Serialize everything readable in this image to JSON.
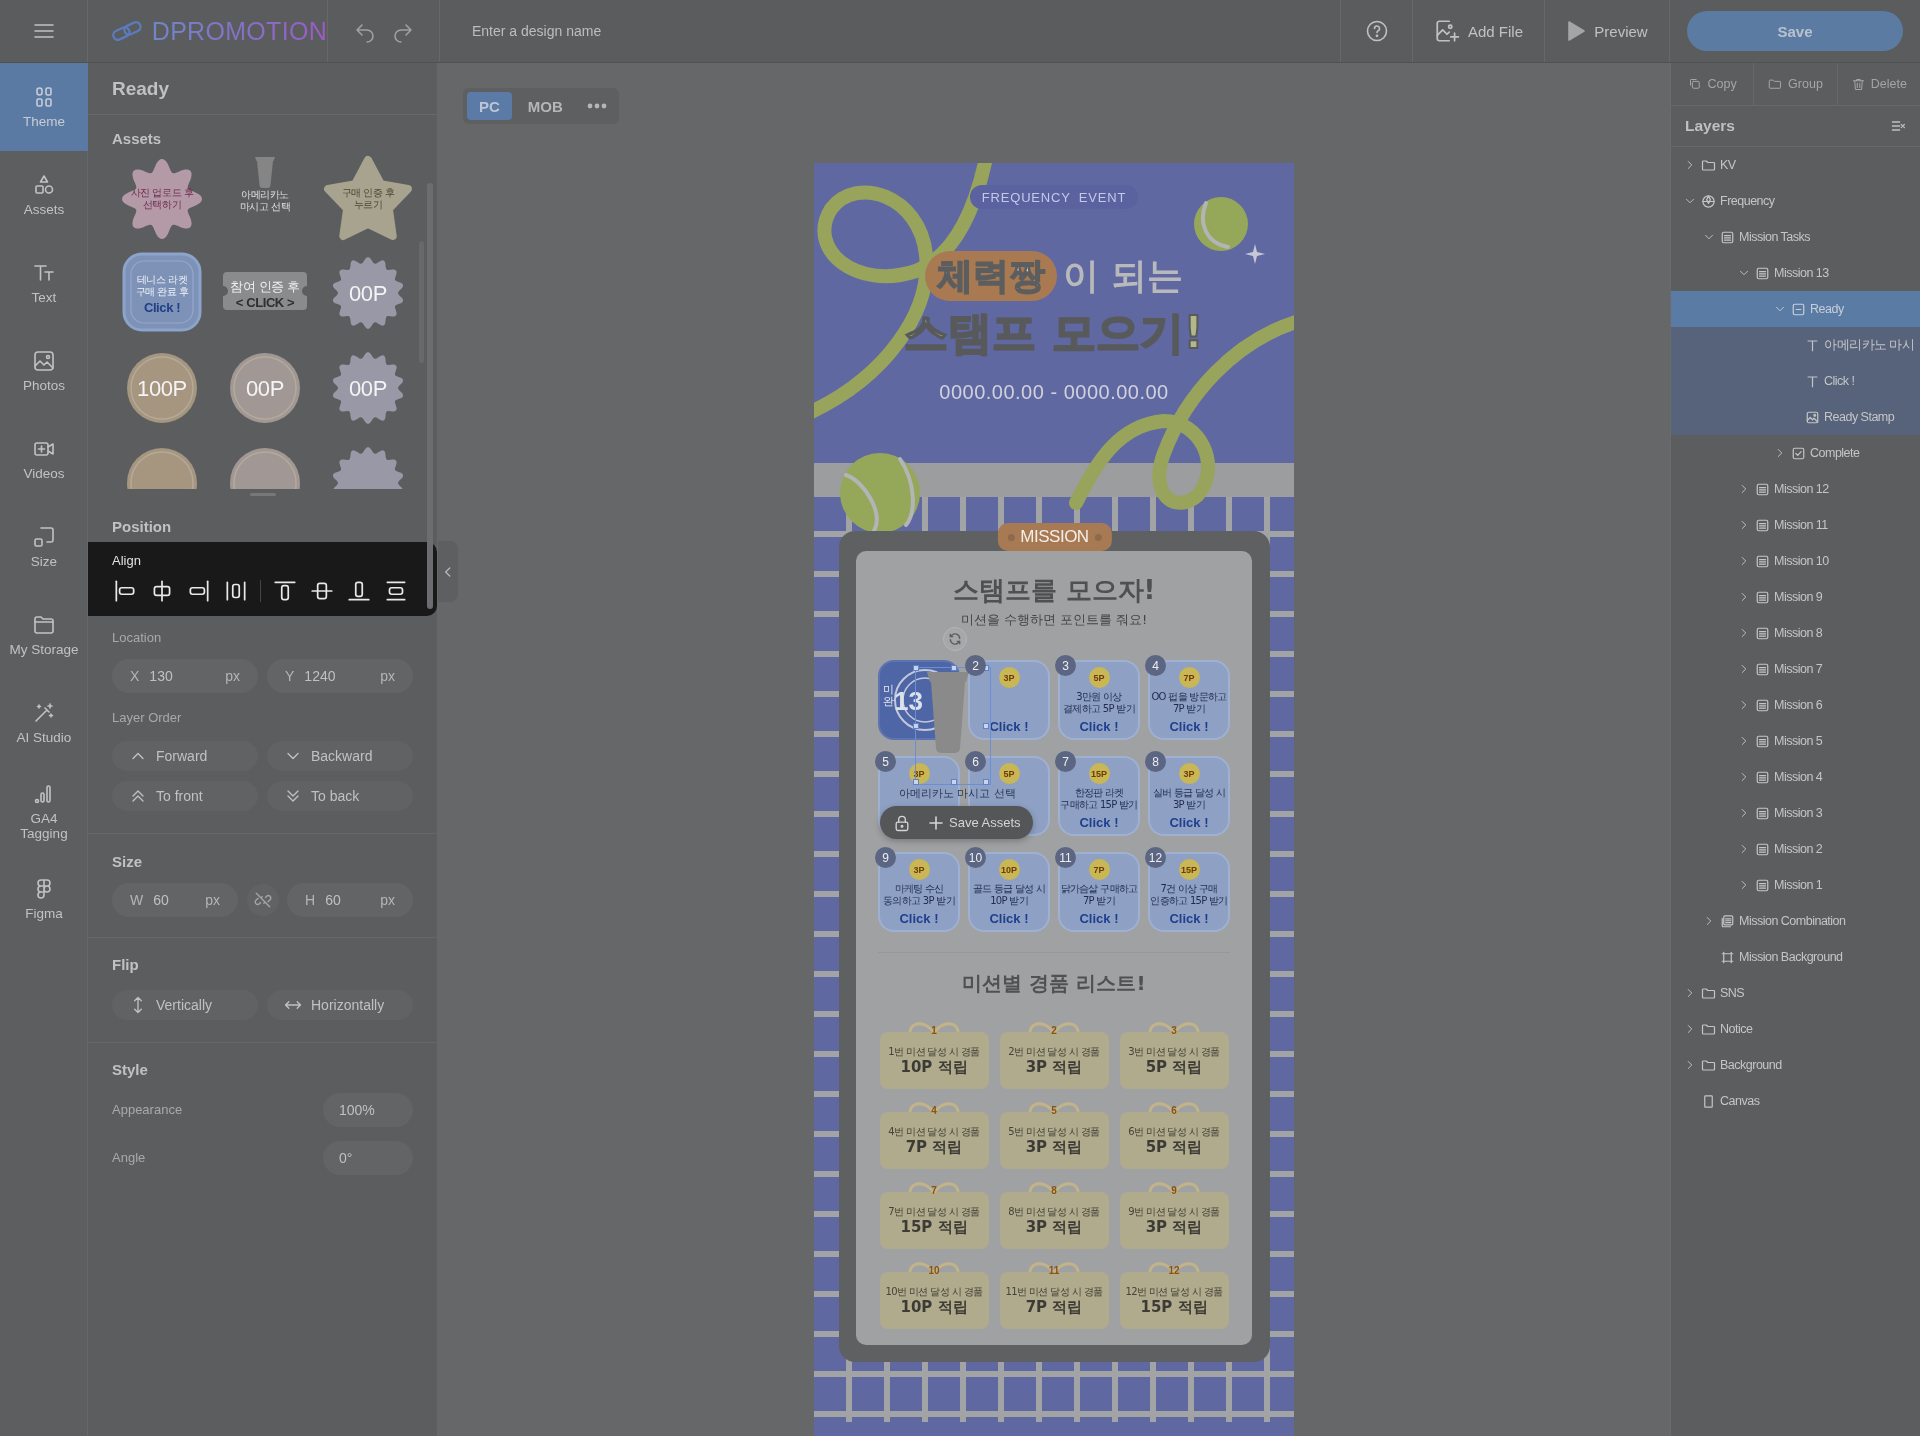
{
  "topbar": {
    "logo": "DPROMOTION",
    "design_name_placeholder": "Enter a design name",
    "actions": [
      {
        "label": "Add File",
        "kind": "add-file"
      },
      {
        "label": "Preview",
        "kind": "preview"
      }
    ],
    "save": "Save"
  },
  "rail": [
    {
      "label": "Theme",
      "kind": "theme",
      "selected": true
    },
    {
      "label": "Assets",
      "kind": "assets",
      "selected": false
    },
    {
      "label": "Text",
      "kind": "text",
      "selected": false
    },
    {
      "label": "Photos",
      "kind": "photos",
      "selected": false
    },
    {
      "label": "Videos",
      "kind": "videos",
      "selected": false
    },
    {
      "label": "Size",
      "kind": "size",
      "selected": false
    },
    {
      "label": "My Storage",
      "kind": "storage",
      "selected": false
    },
    {
      "label": "AI Studio",
      "kind": "ai",
      "selected": false
    },
    {
      "label": "GA4 Tagging",
      "kind": "ga4",
      "selected": false
    },
    {
      "label": "Figma",
      "kind": "figma",
      "selected": false
    }
  ],
  "panel": {
    "title": "Ready",
    "assets_title": "Assets",
    "assets": [
      {
        "kind": "flower",
        "color": "#b39aa6",
        "text": "사진 업로드 후\n선택하기"
      },
      {
        "kind": "cup",
        "color": "#858585",
        "text": "아메리카노\n마시고 선택"
      },
      {
        "kind": "star",
        "color": "#a8a38f",
        "text": "구매 인증 후\n누르기"
      },
      {
        "kind": "rounded",
        "color": "#7d92b6",
        "text": "테니스 라켓\n구매 완료 후",
        "cta": "Click !"
      },
      {
        "kind": "ticket",
        "color": "#8a8b8c",
        "text": "참여 인증 후",
        "cta": "< CLICK >"
      },
      {
        "kind": "scallop",
        "color": "#9898a6",
        "text": "00P"
      },
      {
        "kind": "coin",
        "color": "#a6957f",
        "text": "100P"
      },
      {
        "kind": "coin",
        "color": "#a19896",
        "text": "00P"
      },
      {
        "kind": "scallop",
        "color": "#9898a6",
        "text": "00P"
      },
      {
        "kind": "coin",
        "color": "#a6957f"
      },
      {
        "kind": "coin",
        "color": "#a19896"
      },
      {
        "kind": "scallop",
        "color": "#9898a6"
      }
    ],
    "position_title": "Position",
    "align_label": "Align",
    "location_label": "Location",
    "location": [
      {
        "label": "X",
        "value": "130",
        "unit": "px"
      },
      {
        "label": "Y",
        "value": "1240",
        "unit": "px"
      }
    ],
    "layer_order_label": "Layer Order",
    "order_buttons": [
      {
        "label": "Forward",
        "kind": "up"
      },
      {
        "label": "Backward",
        "kind": "down"
      },
      {
        "label": "To front",
        "kind": "top"
      },
      {
        "label": "To back",
        "kind": "bottom"
      }
    ],
    "size_title": "Size",
    "size": [
      {
        "label": "W",
        "value": "60",
        "unit": "px"
      },
      {
        "label": "H",
        "value": "60",
        "unit": "px"
      }
    ],
    "flip_title": "Flip",
    "flip_buttons": [
      {
        "label": "Vertically",
        "kind": "vertical"
      },
      {
        "label": "Horizontally",
        "kind": "horizontal"
      }
    ],
    "style_title": "Style",
    "style_rows": [
      {
        "label": "Appearance",
        "value": "100%"
      },
      {
        "label": "Angle",
        "value": "0°"
      }
    ]
  },
  "view_tabs": [
    {
      "label": "PC",
      "selected": true
    },
    {
      "label": "MOB",
      "selected": false
    }
  ],
  "design": {
    "badge": "FREQUENCY EVENT",
    "headline_highlight": "체력짱",
    "headline_rest": "이 되는",
    "headline_title": "스탬프 모으기!",
    "dates": "0000.00.00 - 0000.00.00",
    "mission_label": "MISSION",
    "card_title": "스탬프를 모으자!",
    "card_subtitle": "미션을 수행하면 포인트를 줘요!",
    "selected_stamp": {
      "number": "13",
      "status": "미완",
      "label": "아메리카노 마시고 선택"
    },
    "save_assets": "Save Assets",
    "stamps": [
      {
        "number": "2",
        "points": "3P",
        "click": "Click !"
      },
      {
        "number": "3",
        "points": "5P",
        "text": "3만원 이상\n결제하고 5P 받기",
        "click": "Click !"
      },
      {
        "number": "4",
        "points": "7P",
        "text": "OO 펍을 방문하고\n7P 받기",
        "click": "Click !"
      },
      {
        "number": "5",
        "points": "3P"
      },
      {
        "number": "6",
        "points": "5P"
      },
      {
        "number": "7",
        "points": "15P",
        "text": "한정판 라켓\n구매하고 15P 받기",
        "click": "Click !"
      },
      {
        "number": "8",
        "points": "3P",
        "text": "실버 등급 달성 시\n3P 받기",
        "click": "Click !"
      },
      {
        "number": "9",
        "points": "3P",
        "text": "마케팅 수신\n동의하고 3P 받기",
        "click": "Click !"
      },
      {
        "number": "10",
        "points": "10P",
        "text": "골드 등급 달성 시\n10P 받기",
        "click": "Click !"
      },
      {
        "number": "11",
        "points": "7P",
        "text": "닭가슴살 구매하고\n7P 받기",
        "click": "Click !"
      },
      {
        "number": "12",
        "points": "15P",
        "text": "7건 이상 구매\n인증하고 15P 받기",
        "click": "Click !"
      }
    ],
    "prize_title": "미션별 경품 리스트!",
    "prizes": [
      {
        "number": "1",
        "caption": "1번 미션 달성 시 경품",
        "reward": "10P 적립"
      },
      {
        "number": "2",
        "caption": "2번 미션 달성 시 경품",
        "reward": "3P 적립"
      },
      {
        "number": "3",
        "caption": "3번 미션 달성 시 경품",
        "reward": "5P 적립"
      },
      {
        "number": "4",
        "caption": "4번 미션 달성 시 경품",
        "reward": "7P 적립"
      },
      {
        "number": "5",
        "caption": "5번 미션 달성 시 경품",
        "reward": "3P 적립"
      },
      {
        "number": "6",
        "caption": "6번 미션 달성 시 경품",
        "reward": "5P 적립"
      },
      {
        "number": "7",
        "caption": "7번 미션 달성 시 경품",
        "reward": "15P 적립"
      },
      {
        "number": "8",
        "caption": "8번 미션 달성 시 경품",
        "reward": "3P 적립"
      },
      {
        "number": "9",
        "caption": "9번 미션 달성 시 경품",
        "reward": "3P 적립"
      },
      {
        "number": "10",
        "caption": "10번 미션 달성 시 경품",
        "reward": "10P 적립"
      },
      {
        "number": "11",
        "caption": "11번 미션 달성 시 경품",
        "reward": "7P 적립"
      },
      {
        "number": "12",
        "caption": "12번 미션 달성 시 경품",
        "reward": "15P 적립"
      }
    ]
  },
  "edit_actions": [
    {
      "label": "Copy",
      "kind": "copy",
      "disabled": true
    },
    {
      "label": "Group",
      "kind": "group",
      "disabled": true
    },
    {
      "label": "Delete",
      "kind": "delete",
      "disabled": true
    }
  ],
  "layers_title": "Layers",
  "layers": [
    {
      "label": "KV",
      "kind": "folder",
      "expanded": false,
      "selected": false
    },
    {
      "label": "Frequency",
      "kind": "component",
      "expanded": true,
      "selected": false,
      "children": [
        {
          "label": "Mission Tasks",
          "kind": "list",
          "expanded": true,
          "selected": false,
          "children": [
            {
              "label": "Mission 13",
              "kind": "list",
              "expanded": true,
              "selected": false,
              "children": [
                {
                  "label": "Ready",
                  "kind": "state",
                  "expanded": true,
                  "selected": true,
                  "children": [
                    {
                      "label": "아메리카노 마시",
                      "kind": "text",
                      "selected": false
                    },
                    {
                      "label": "Click !",
                      "kind": "text",
                      "selected": false
                    },
                    {
                      "label": "Ready Stamp",
                      "kind": "image",
                      "selected": false
                    }
                  ]
                },
                {
                  "label": "Complete",
                  "kind": "check",
                  "expanded": false,
                  "selected": false
                }
              ]
            },
            {
              "label": "Mission 12",
              "kind": "list",
              "expanded": false,
              "selected": false
            },
            {
              "label": "Mission 11",
              "kind": "list",
              "expanded": false,
              "selected": false
            },
            {
              "label": "Mission 10",
              "kind": "list",
              "expanded": false,
              "selected": false
            },
            {
              "label": "Mission 9",
              "kind": "list",
              "expanded": false,
              "selected": false
            },
            {
              "label": "Mission 8",
              "kind": "list",
              "expanded": false,
              "selected": false
            },
            {
              "label": "Mission 7",
              "kind": "list",
              "expanded": false,
              "selected": false
            },
            {
              "label": "Mission 6",
              "kind": "list",
              "expanded": false,
              "selected": false
            },
            {
              "label": "Mission 5",
              "kind": "list",
              "expanded": false,
              "selected": false
            },
            {
              "label": "Mission 4",
              "kind": "list",
              "expanded": false,
              "selected": false
            },
            {
              "label": "Mission 3",
              "kind": "list",
              "expanded": false,
              "selected": false
            },
            {
              "label": "Mission 2",
              "kind": "list",
              "expanded": false,
              "selected": false
            },
            {
              "label": "Mission 1",
              "kind": "list",
              "expanded": false,
              "selected": false
            }
          ]
        },
        {
          "label": "Mission Combination",
          "kind": "stack",
          "expanded": false,
          "selected": false
        },
        {
          "label": "Mission Background",
          "kind": "frame",
          "selected": false
        }
      ]
    },
    {
      "label": "SNS",
      "kind": "folder",
      "expanded": false,
      "selected": false
    },
    {
      "label": "Notice",
      "kind": "folder",
      "expanded": false,
      "selected": false
    },
    {
      "label": "Background",
      "kind": "folder",
      "expanded": false,
      "selected": false
    },
    {
      "label": "Canvas",
      "kind": "canvas",
      "selected": false
    }
  ]
}
